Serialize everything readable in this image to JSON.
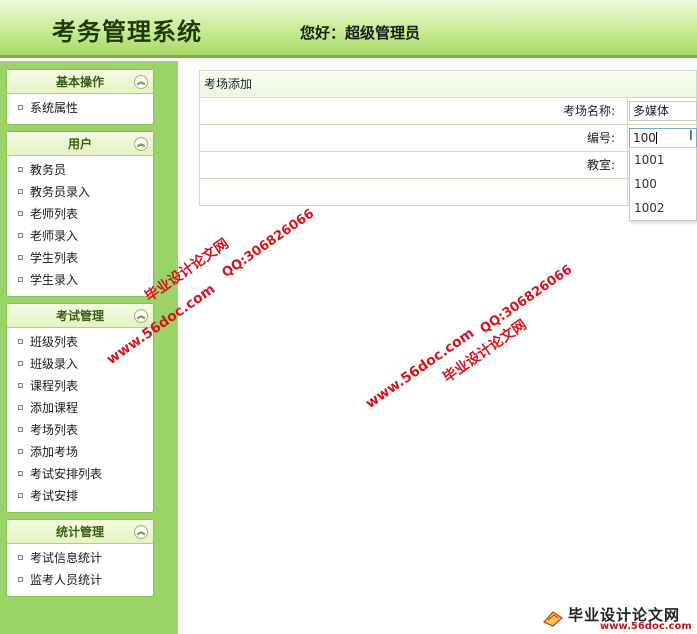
{
  "header": {
    "app_title": "考务管理系统",
    "greeting": "您好：超级管理员"
  },
  "sidebar": {
    "panels": [
      {
        "title": "基本操作",
        "items": [
          "系统属性"
        ]
      },
      {
        "title": "用户",
        "items": [
          "教务员",
          "教务员录入",
          "老师列表",
          "老师录入",
          "学生列表",
          "学生录入"
        ]
      },
      {
        "title": "考试管理",
        "items": [
          "班级列表",
          "班级录入",
          "课程列表",
          "添加课程",
          "考场列表",
          "添加考场",
          "考试安排列表",
          "考试安排"
        ]
      },
      {
        "title": "统计管理",
        "items": [
          "考试信息统计",
          "监考人员统计"
        ]
      }
    ],
    "collapse_glyph": "︽"
  },
  "main": {
    "title": "考场添加",
    "fields": {
      "name_label": "考场名称:",
      "name_value": "多媒体",
      "code_label": "编号:",
      "code_value": "100",
      "room_label": "教室:"
    },
    "autocomplete": [
      "1001",
      "100",
      "1002"
    ]
  },
  "watermarks": {
    "site_cn": "毕业设计论文网",
    "site_url": "www.56doc.com",
    "qq": "QQ:306826066"
  },
  "footer_logo": {
    "name": "毕业设计论文网",
    "url": "www.56doc.com"
  }
}
